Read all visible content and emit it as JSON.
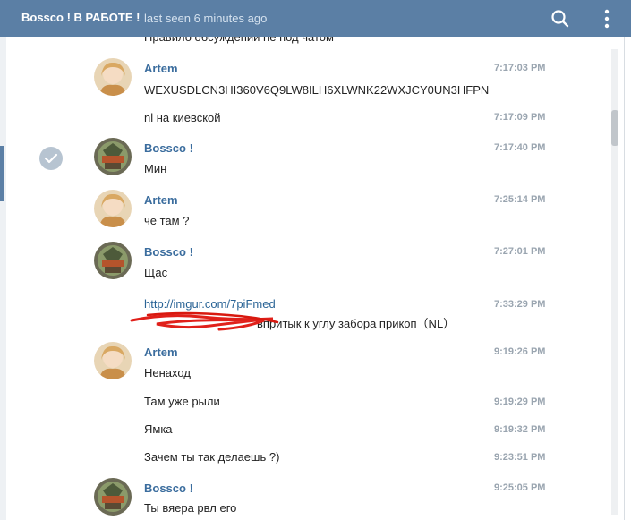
{
  "header": {
    "title": "Bossco ! В РАБОТЕ !",
    "status": "last seen 6 minutes ago",
    "search_icon": "search-icon",
    "more_icon": "more-vertical-icon"
  },
  "colors": {
    "header_bg": "#5b7fa5",
    "name_color": "#3b6d9e",
    "link_color": "#2a6496",
    "time_color": "#9aa5b0"
  },
  "chat": {
    "partial_text": "Правило обсуждений не под чатом",
    "messages": [
      {
        "author": "Artem",
        "avatar": "artem-avatar",
        "time": "7:17:03 PM",
        "text": "WEXUSDLCN3HI360V6Q9LW8ILH6XLWNK22WXJCY0UN3HFPN"
      },
      {
        "author": "",
        "time": "7:17:09 PM",
        "text": "nl на киевской"
      },
      {
        "author": "Bossco !",
        "avatar": "bossco-avatar",
        "time": "7:17:40 PM",
        "text": "Мин",
        "selected": true
      },
      {
        "author": "Artem",
        "avatar": "artem-avatar",
        "time": "7:25:14 PM",
        "text": "че там ?"
      },
      {
        "author": "Bossco !",
        "avatar": "bossco-avatar",
        "time": "7:27:01 PM",
        "text": "Щас"
      },
      {
        "author": "",
        "time": "7:33:29 PM",
        "link": "http://imgur.com/7piFmed",
        "text": "впритык к углу забора прикоп（NL）"
      },
      {
        "author": "Artem",
        "avatar": "artem-avatar",
        "time": "9:19:26 PM",
        "text": "Ненаход"
      },
      {
        "author": "",
        "time": "9:19:29 PM",
        "text": "Там уже рыли"
      },
      {
        "author": "",
        "time": "9:19:32 PM",
        "text": "Ямка"
      },
      {
        "author": "",
        "time": "9:23:51 PM",
        "text": "Зачем ты так делаешь ?)"
      },
      {
        "author": "Bossco !",
        "avatar": "bossco-avatar",
        "time": "9:25:05 PM",
        "text": "Ты вяера рвл его"
      }
    ]
  }
}
